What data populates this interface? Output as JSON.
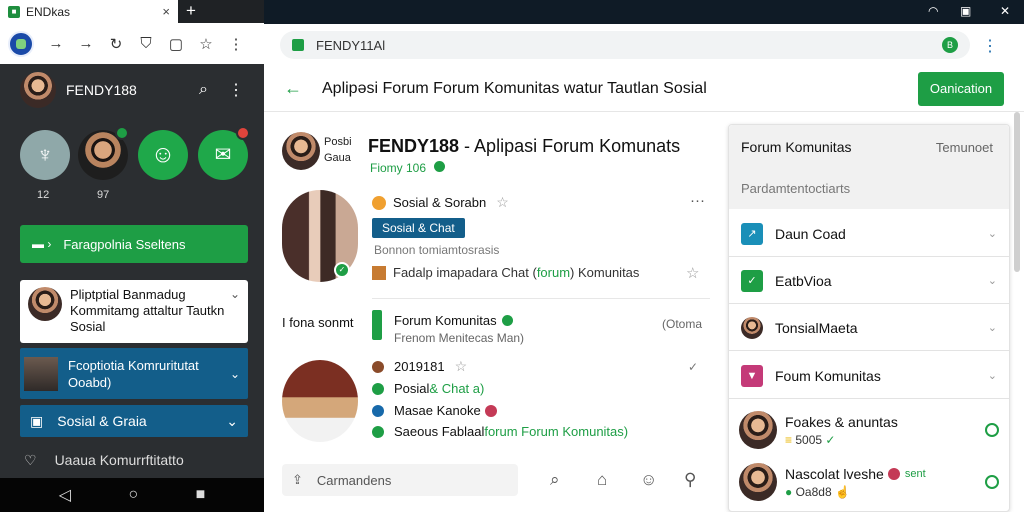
{
  "browser": {
    "tab_title": "ENDkas",
    "tab_close": "×",
    "new_tab": "+",
    "url": "FENDY11Al",
    "ext_icon": "B",
    "toolbar_icons": [
      "arrow-right-icon",
      "forward-icon",
      "refresh-icon",
      "shield-icon",
      "page-icon",
      "star-icon",
      "menu-icon"
    ]
  },
  "left": {
    "app_name": "FENDY188",
    "stories": [
      {
        "icon": "microphone-icon",
        "count": "12"
      },
      {
        "icon": "avatar",
        "count": "97"
      },
      {
        "icon": "person-icon",
        "count": ""
      },
      {
        "icon": "chat-icon",
        "count": ""
      }
    ],
    "primary_button": "Faragpolnia Sseltens",
    "post_card": "Pliptptial Banmadug Kommitamg attaltur Tautkn Sosial",
    "list_selected": "Fcoptiotia Komruritutat Ooabd)",
    "list_item_2": "Sosial & Graia",
    "list_item_3": "Uaaua Komurrftitatto"
  },
  "right": {
    "page_title": "Aplipəsi Forum Forum Komunitas watur Tautlan Sosial",
    "header_button": "Oanication",
    "profile": {
      "side_top": "Posbi",
      "side_bottom": "Gaua",
      "title_bold": "FENDY188",
      "title_rest": " - Aplipasi Forum Komunats",
      "sub": "Fiomy 106"
    },
    "post": {
      "head": "Sosial & Sorabn",
      "chip": "Sosial & Chat",
      "meta": "Bonnon tomiamtosrasis",
      "line_prefix": "Fadalp imapadara Chat ( ",
      "line_link": "forum",
      "line_suffix": ") Komunitas"
    },
    "row": {
      "label": "I fona sonmt",
      "title": "Forum Komunitas",
      "sub": "Frenom Menitecas Man)",
      "time": "(Otoma"
    },
    "details": [
      {
        "text": "2019181",
        "icon": "avatar"
      },
      {
        "text_a": "Posial ",
        "text_b": "& Chat a)",
        "icon": "green"
      },
      {
        "text": "Masae Kanoke",
        "icon": "blue"
      },
      {
        "text_a": "Saeous Fablaal ",
        "text_b": "forum Forum Komunitas)",
        "icon": "green"
      }
    ],
    "comment_placeholder": "Carmandens"
  },
  "side_panel": {
    "title": "Forum Komunitas",
    "right_label": "Temunoet",
    "subtitle": "Pardamtentoctiarts",
    "items": [
      {
        "label": "Daun Coad",
        "color": "#1a8fb8",
        "icon": "share-icon"
      },
      {
        "label": "EatbVioa",
        "color": "#1e9e45",
        "icon": "chat-icon"
      },
      {
        "label": "TonsialMaeta",
        "color": "#d9a57e",
        "icon": "avatar"
      },
      {
        "label": "Foum Komunitas",
        "color": "#c43a78",
        "icon": "bookmark-icon"
      }
    ],
    "users": [
      {
        "name": "Foakes & anuntas",
        "sub": "5005"
      },
      {
        "name": "Nascolat lveshe",
        "tag": "sent",
        "sub": "Oa8d8"
      }
    ]
  },
  "colors": {
    "accent": "#1e9e45",
    "blue": "#135e8a",
    "dark": "#2b2e31"
  }
}
